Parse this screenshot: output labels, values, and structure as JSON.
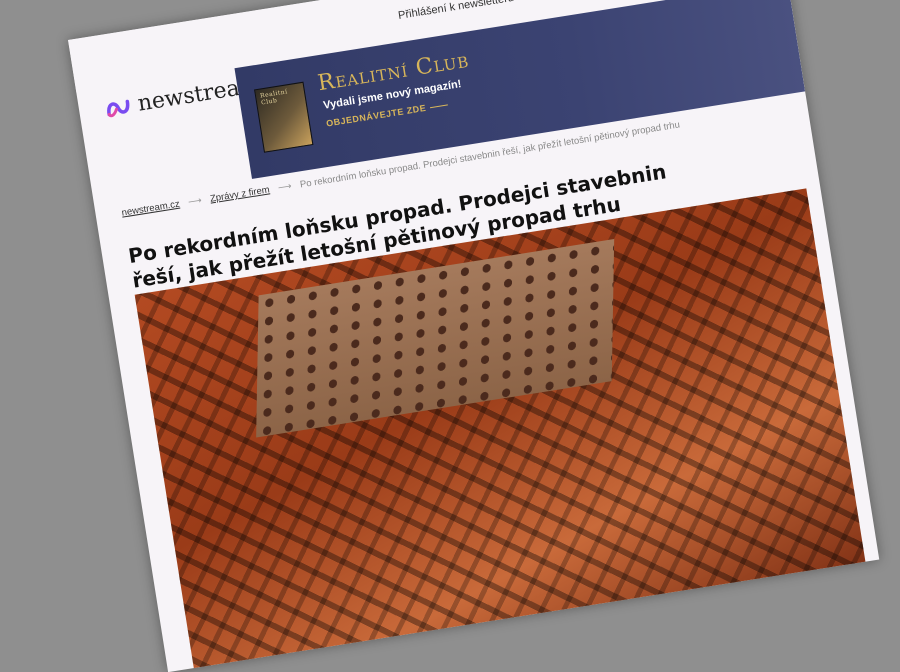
{
  "header": {
    "login_link": "Přihlášení k newsletteru",
    "social_icons": [
      "twitter-icon",
      "facebook-icon",
      "instagram-icon",
      "rss-icon"
    ],
    "close": "×"
  },
  "logo": {
    "text": "newstream"
  },
  "banner": {
    "title": "Realitní Club",
    "subtitle": "Vydali jsme nový magazín!",
    "cta": "OBJEDNÁVEJTE ZDE",
    "magazine_cover_text": "Realitní Club"
  },
  "breadcrumb": {
    "home": "newstream.cz",
    "section": "Zprávy z firem",
    "current": "Po rekordním loňsku propad. Prodejci stavebnin řeší, jak přežít letošní pětinový propad trhu"
  },
  "article": {
    "headline": "Po rekordním loňsku propad. Prodejci stavebnin řeší, jak přežít letošní pětinový propad trhu"
  }
}
